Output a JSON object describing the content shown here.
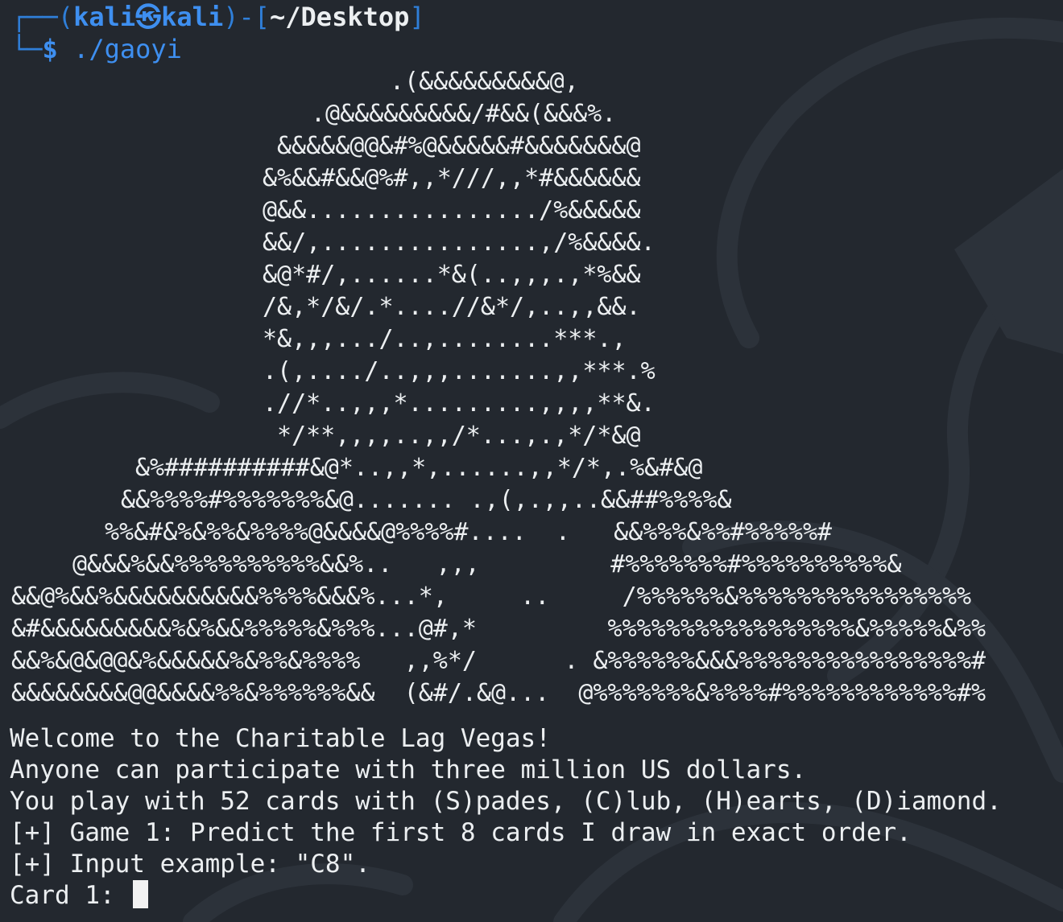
{
  "prompt": {
    "box_top": "┌──(",
    "user": "kali",
    "skull": "㉿",
    "host": "kali",
    "box_mid": ")-[",
    "dir": "~/Desktop",
    "box_end": "]",
    "box_bottom": "└─",
    "dollar": "$",
    "command": " ./gaoyi"
  },
  "ascii_art": [
    ".(&&&&&&&&&@,",
    ".@&&&&&&&&&/#&&(&&&%.",
    "&&&&&@@&#%@&&&&&#&&&&&&&@",
    "&%&&#&&@%#,,*///,,*#&&&&&&",
    "@&&................/%&&&&&",
    "&&/,...............,/%&&&&.",
    "&@*#/,......*&(..,,,.,*%&&",
    "/&,*/&/.*....//&*/,..,,&&.",
    "*&,,,.../..,........***.,",
    ".(,..../..,,,.......,,***.%",
    ".//*..,,,*.........,,,,**&.",
    "*/**,,,,..,,/*...,.,*/*&@",
    "&%##########&@*..,,*,......,,*/*,.%&#&@",
    "&&%%%%#%%%%%%%&@....... .,(,.,,..&&##%%%%&",
    "%%&#&%&%%&%%%%@&&&&@%%%%#....  .   &&%%%&%%#%%%%%#",
    "@&&&%&&%%%%%%%%%%&&%..   ,,,         #%%%%%%%#%%%%%%%%%%&",
    "&&@%&&%&&&&&&&&&&%%%%&&&%...*,     ..     /%%%%%%&%%%%%%%%%%%%%%%%",
    "&#&&&&&&&&&%&%&&%%%%%&%%%...@#,*         %%%%%%%%%%%%%%%%%&%%%%%&%%",
    "&&%&@&@@&%&&&&&%&%%&%%%%   ,,%*/      . &%%%%%%&&&%%%%%%%%%%%%%%%%#",
    "&&&&&&&&@@&&&&%%&%%%%%%&&  (&#/.&@...  @%%%%%%%&%%%%#%%%%%%%%%%%%#%"
  ],
  "output": [
    "Welcome to the Charitable Lag Vegas!",
    "Anyone can participate with three million US dollars.",
    "You play with 52 cards with (S)pades, (C)lub, (H)earts, (D)iamond.",
    "[+] Game 1: Predict the first 8 cards I draw in exact order.",
    "[+] Input example: \"C8\"."
  ],
  "input_prompt": "Card 1: "
}
